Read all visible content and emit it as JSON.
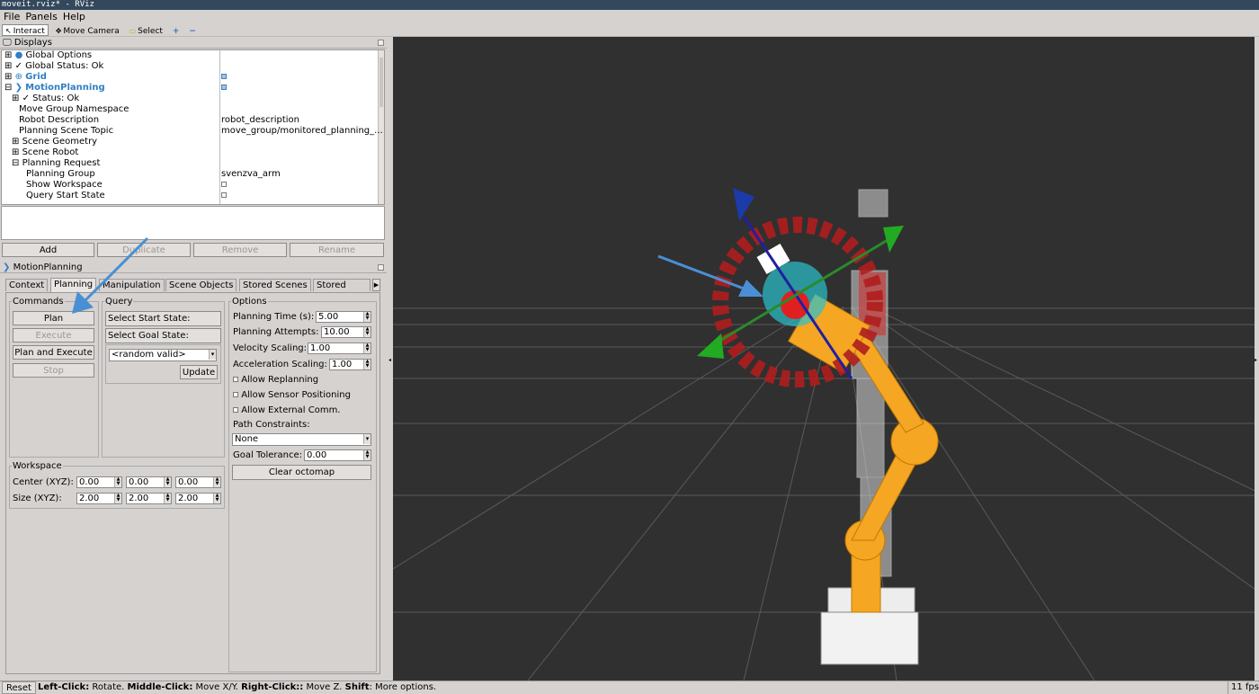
{
  "window": {
    "title": "moveit.rviz* - RViz"
  },
  "menu": {
    "file": "File",
    "panels": "Panels",
    "help": "Help"
  },
  "toolbar": {
    "interact": "Interact",
    "move_camera": "Move Camera",
    "select": "Select",
    "add_icon": "+",
    "remove_icon": "−"
  },
  "displays": {
    "title": "Displays",
    "rows": [
      {
        "label": "Global Options",
        "value": ""
      },
      {
        "label": "Global Status: Ok",
        "value": ""
      },
      {
        "label": "Grid",
        "value": ""
      },
      {
        "label": "MotionPlanning",
        "value": ""
      },
      {
        "label": "Status: Ok",
        "value": ""
      },
      {
        "label": "Move Group Namespace",
        "value": ""
      },
      {
        "label": "Robot Description",
        "value": "robot_description"
      },
      {
        "label": "Planning Scene Topic",
        "value": "move_group/monitored_planning_..."
      },
      {
        "label": "Scene Geometry",
        "value": ""
      },
      {
        "label": "Scene Robot",
        "value": ""
      },
      {
        "label": "Planning Request",
        "value": ""
      },
      {
        "label": "Planning Group",
        "value": "svenzva_arm"
      },
      {
        "label": "Show Workspace",
        "value": ""
      },
      {
        "label": "Query Start State",
        "value": ""
      }
    ],
    "buttons": {
      "add": "Add",
      "duplicate": "Duplicate",
      "remove": "Remove",
      "rename": "Rename"
    }
  },
  "motion_planning": {
    "title": "MotionPlanning",
    "tabs": [
      "Context",
      "Planning",
      "Manipulation",
      "Scene Objects",
      "Stored Scenes",
      "Stored Stat"
    ],
    "commands": {
      "title": "Commands",
      "plan": "Plan",
      "execute": "Execute",
      "plan_and_execute": "Plan and Execute",
      "stop": "Stop"
    },
    "query": {
      "title": "Query",
      "start_state": "Select Start State:",
      "goal_state": "Select Goal State:",
      "goal_value": "<random valid>",
      "update": "Update"
    },
    "options": {
      "title": "Options",
      "planning_time_label": "Planning Time (s):",
      "planning_time": "5.00",
      "planning_attempts_label": "Planning Attempts:",
      "planning_attempts": "10.00",
      "velocity_scaling_label": "Velocity Scaling:",
      "velocity_scaling": "1.00",
      "acceleration_scaling_label": "Acceleration Scaling:",
      "acceleration_scaling": "1.00",
      "allow_replanning": "Allow Replanning",
      "allow_sensor_positioning": "Allow Sensor Positioning",
      "allow_external_comm": "Allow External Comm.",
      "path_constraints_label": "Path Constraints:",
      "path_constraints": "None",
      "goal_tolerance_label": "Goal Tolerance:",
      "goal_tolerance": "0.00",
      "clear_octomap": "Clear octomap"
    },
    "workspace": {
      "title": "Workspace",
      "center_label": "Center (XYZ):",
      "center": [
        "0.00",
        "0.00",
        "0.00"
      ],
      "size_label": "Size (XYZ):",
      "size": [
        "2.00",
        "2.00",
        "2.00"
      ]
    }
  },
  "status": {
    "reset": "Reset",
    "hint_left": "Left-Click:",
    "hint_left_t": " Rotate. ",
    "hint_mid": "Middle-Click:",
    "hint_mid_t": " Move X/Y. ",
    "hint_right": "Right-Click::",
    "hint_right_t": " Move Z. ",
    "hint_shift": "Shift",
    "hint_shift_t": ": More options.",
    "fps": "11 fps"
  },
  "colors": {
    "title_bar": "#33485c",
    "viewport_bg": "#303030",
    "robot_orange": "#f5a623",
    "annotation_arrow": "#4a8fd4",
    "accent_blue": "#2f7fc4"
  }
}
